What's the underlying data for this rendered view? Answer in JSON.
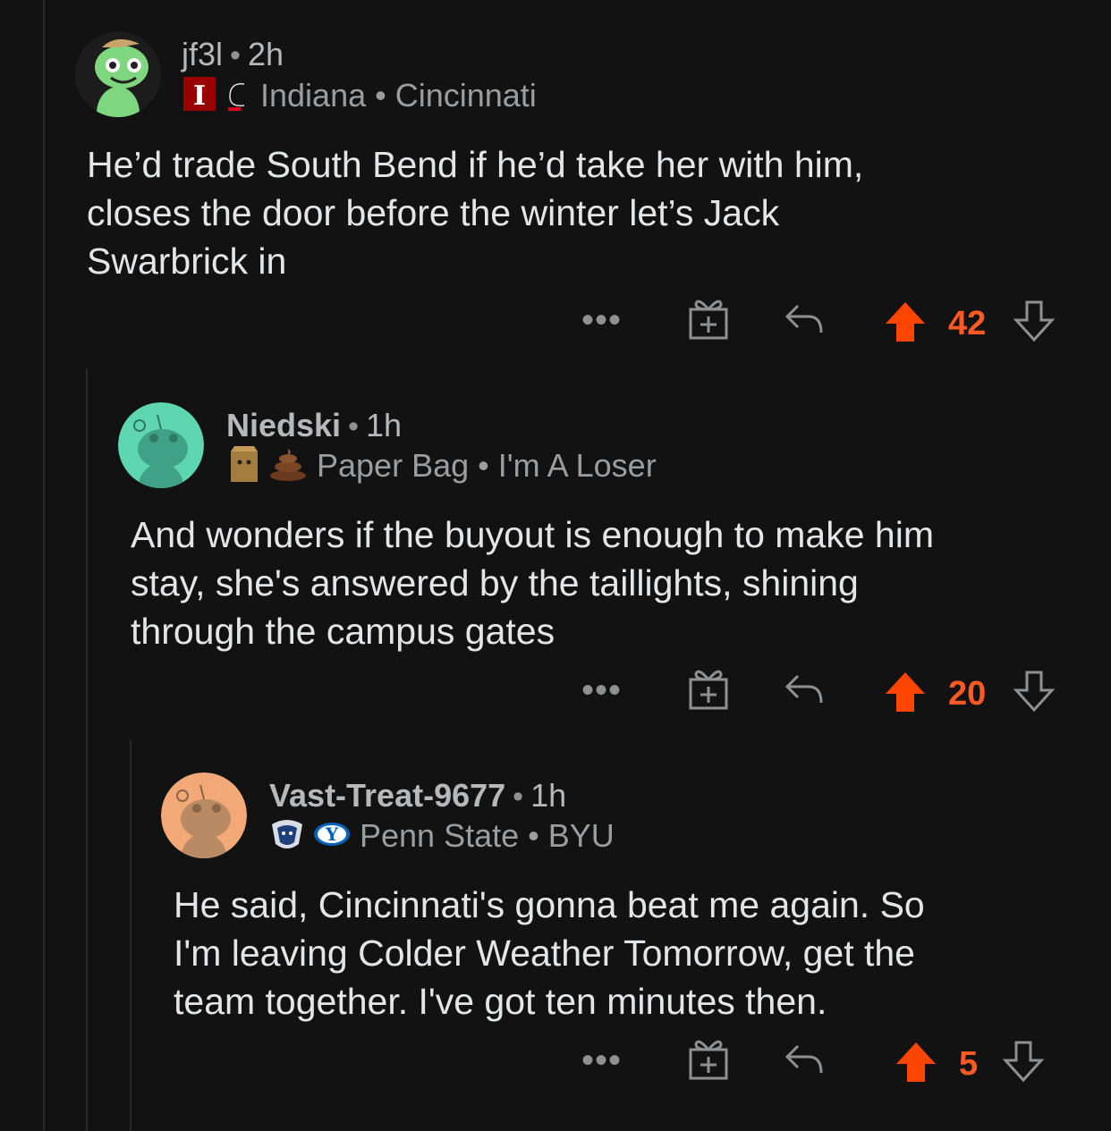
{
  "colors": {
    "upvote": "#ff4500",
    "background": "#121212"
  },
  "comments": [
    {
      "username": "jf3l",
      "time": "2h",
      "flair_text": "Indiana • Cincinnati",
      "flair_icons": [
        "indiana-logo-icon",
        "cincinnati-logo-icon"
      ],
      "body": [
        "He’d trade South Bend if he’d take her with him,",
        "closes the door before the winter let’s Jack",
        "Swarbrick in"
      ],
      "score": "42"
    },
    {
      "username": "Niedski",
      "time": "1h",
      "flair_text": "Paper Bag • I'm A Loser",
      "flair_icons": [
        "paper-bag-icon",
        "poop-icon"
      ],
      "body": [
        "And wonders if the buyout is enough to make him",
        "stay, she's answered by the taillights, shining",
        "through the campus gates"
      ],
      "score": "20"
    },
    {
      "username": "Vast-Treat-9677",
      "time": "1h",
      "flair_text": "Penn State • BYU",
      "flair_icons": [
        "penn-state-logo-icon",
        "byu-logo-icon"
      ],
      "body": [
        "He said, Cincinnati's gonna beat me again. So",
        "I'm leaving Colder Weather Tomorrow, get the",
        "team together. I've got ten minutes then."
      ],
      "score": "5"
    }
  ],
  "actions": {
    "more_label": "•••"
  }
}
